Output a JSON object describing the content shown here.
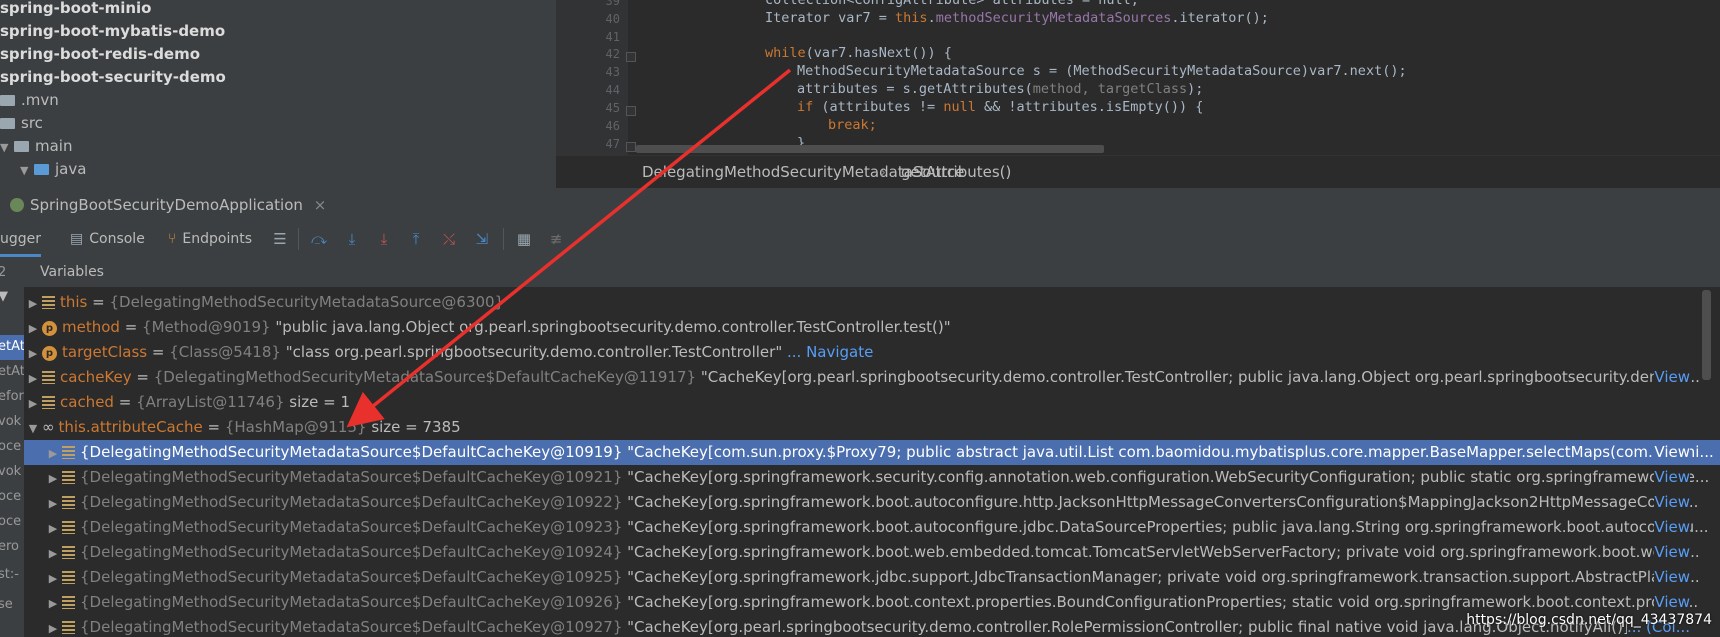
{
  "project": {
    "items": [
      {
        "label": "spring-boot-minio",
        "bold": true
      },
      {
        "label": "spring-boot-mybatis-demo",
        "bold": true
      },
      {
        "label": "spring-boot-redis-demo",
        "bold": true
      },
      {
        "label": "spring-boot-security-demo",
        "bold": true
      },
      {
        "label": ".mvn"
      },
      {
        "label": "src"
      },
      {
        "label": "main"
      },
      {
        "label": "java"
      }
    ]
  },
  "editor": {
    "line_numbers": [
      "39",
      "40",
      "41",
      "42",
      "43",
      "44",
      "45",
      "46",
      "47"
    ],
    "lines": {
      "l39": "collection<ConfigAttribute> attributes = null;",
      "l40_a": "Iterator var7 = ",
      "l40_this": "this",
      "l40_b": ".",
      "l40_field": "methodSecurityMetadataSources",
      "l40_c": ".iterator();",
      "l42_kw": "while",
      "l42_rest": "(var7.hasNext()) {",
      "l43": "MethodSecurityMetadataSource s = (MethodSecurityMetadataSource)var7.next();",
      "l44_a": "attributes = s.getAttributes(",
      "l44_hs": "method, targetClass",
      "l44_b": ");",
      "l45_kw": "if",
      "l45_a": " (attributes != ",
      "l45_null": "null",
      "l45_b": " && !attributes.isEmpty()) {",
      "l46": "break;",
      "l47": "}"
    },
    "breadcrumb": {
      "class": "DelegatingMethodSecuritySource",
      "class_full": "DelegatingMethodSecurityMetadataSource",
      "separator": "›",
      "method": "getAttributes()"
    }
  },
  "run": {
    "tab_label": "SpringBootSecurityDemoApplication",
    "close": "×"
  },
  "toolbar": {
    "debugger": "ugger",
    "console": "Console",
    "endpoints": "Endpoints"
  },
  "variables": {
    "header": "Variables",
    "rows": [
      {
        "name": "this",
        "id": "{DelegatingMethodSecurityMetadataSource@6300}",
        "value": "",
        "link": ""
      },
      {
        "name": "method",
        "id": "{Method@9019}",
        "value": "\"public java.lang.Object org.pearl.springbootsecurity.demo.controller.TestController.test()\"",
        "link": ""
      },
      {
        "name": "targetClass",
        "id": "{Class@5418}",
        "value": "\"class org.pearl.springbootsecurity.demo.controller.TestController\"",
        "link": "... Navigate"
      },
      {
        "name": "cacheKey",
        "id": "{DelegatingMethodSecurityMetadataSource$DefaultCacheKey@11917}",
        "value": "\"CacheKey[org.pearl.springbootsecurity.demo.controller.TestController; public java.lang.Object org.pearl.springbootsecurity.demo.c...",
        "link": "View"
      },
      {
        "name": "cached",
        "id": "{ArrayList@11746}",
        "value": "size = 1",
        "link": ""
      },
      {
        "name": "this.attributeCache",
        "id": "{HashMap@9115}",
        "value": "size = 7385",
        "link": ""
      },
      {
        "name": "",
        "id": "{DelegatingMethodSecurityMetadataSource$DefaultCacheKey@10919}",
        "value": "\"CacheKey[com.sun.proxy.$Proxy79; public abstract java.util.List com.baomidou.mybatisplus.core.mapper.BaseMapper.selectMaps(com.baomi...",
        "link": "View"
      },
      {
        "name": "",
        "id": "{DelegatingMethodSecurityMetadataSource$DefaultCacheKey@10921}",
        "value": "\"CacheKey[org.springframework.security.config.annotation.web.configuration.WebSecurityConfiguration; public static org.springframework.se...",
        "link": "View"
      },
      {
        "name": "",
        "id": "{DelegatingMethodSecurityMetadataSource$DefaultCacheKey@10922}",
        "value": "\"CacheKey[org.springframework.boot.autoconfigure.http.JacksonHttpMessageConvertersConfiguration$MappingJackson2HttpMessageConve...",
        "link": "View"
      },
      {
        "name": "",
        "id": "{DelegatingMethodSecurityMetadataSource$DefaultCacheKey@10923}",
        "value": "\"CacheKey[org.springframework.boot.autoconfigure.jdbc.DataSourceProperties; public java.lang.String org.springframework.boot.autoconfigu...",
        "link": "View"
      },
      {
        "name": "",
        "id": "{DelegatingMethodSecurityMetadataSource$DefaultCacheKey@10924}",
        "value": "\"CacheKey[org.springframework.boot.web.embedded.tomcat.TomcatServletWebServerFactory; private void org.springframework.boot.web.e...",
        "link": "View"
      },
      {
        "name": "",
        "id": "{DelegatingMethodSecurityMetadataSource$DefaultCacheKey@10925}",
        "value": "\"CacheKey[org.springframework.jdbc.support.JdbcTransactionManager; private void org.springframework.transaction.support.AbstractPlatfor...",
        "link": "View"
      },
      {
        "name": "",
        "id": "{DelegatingMethodSecurityMetadataSource$DefaultCacheKey@10926}",
        "value": "\"CacheKey[org.springframework.boot.context.properties.BoundConfigurationProperties; static void org.springframework.boot.context.proper...",
        "link": "View"
      },
      {
        "name": "",
        "id": "{DelegatingMethodSecurityMetadataSource$DefaultCacheKey@10927}",
        "value": "\"CacheKey[org.pearl.springbootsecurity.demo.controller.RolePermissionController; public final native void java.lang.Object.notifyAll()]\"",
        "link": "... (Col..."
      }
    ]
  },
  "left_strip": [
    "2",
    "etAt",
    "etAt",
    "efor",
    "vok",
    "oce",
    "vok",
    "oce",
    "oce",
    "ero",
    "st:-",
    "se"
  ],
  "watermark": "https://blog.csdn.net/qq_43437874",
  "colors": {
    "accent": "#4b6eaf",
    "keyword": "#cc7832",
    "arrow": "#e8302c",
    "link": "#589df6"
  }
}
